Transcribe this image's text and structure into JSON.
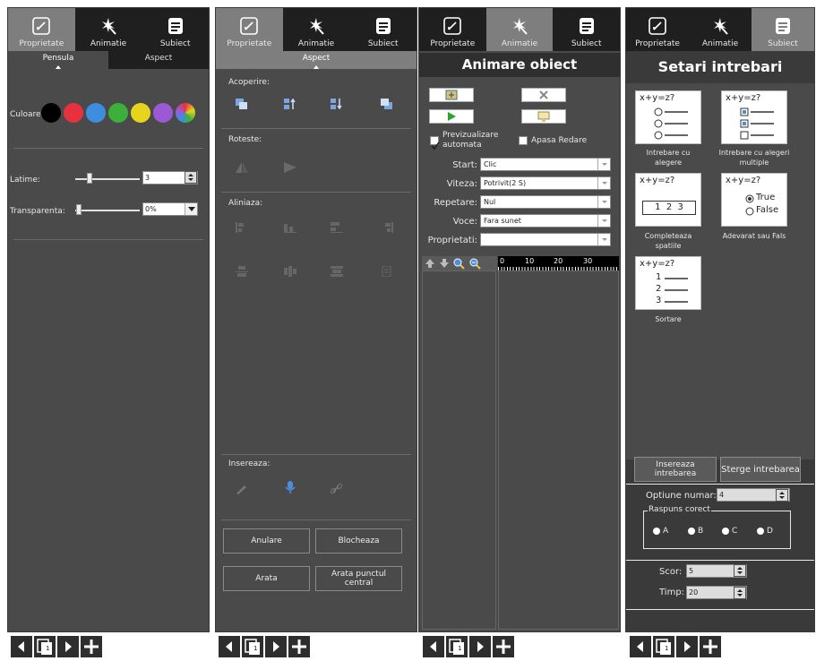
{
  "tabs": {
    "proprietate": "Proprietate",
    "animatie": "Animatie",
    "subiect": "Subiect"
  },
  "panel1": {
    "subtabs": [
      "Pensula",
      "Aspect"
    ],
    "culoare_label": "Culoare",
    "colors": [
      "#000000",
      "#e8313e",
      "#3e8ee0",
      "#3bb13b",
      "#e6d51c",
      "#9b59d6",
      "rainbow"
    ],
    "latime_label": "Latime:",
    "latime_value": "3",
    "transparenta_label": "Transparenta:",
    "transparenta_value": "0%"
  },
  "panel2": {
    "subtab": "Aspect",
    "acoperire": "Acoperire:",
    "roteste": "Roteste:",
    "aliniaza": "Aliniaza:",
    "insereaza": "Insereaza:",
    "buttons": {
      "anulare": "Anulare",
      "blocheaza": "Blocheaza",
      "arata": "Arata",
      "arata_central": "Arata punctul central"
    }
  },
  "panel3": {
    "title": "Animare obiect",
    "preview_label": "Previzualizare automata",
    "apasa_label": "Apasa Redare",
    "fields": [
      {
        "label": "Start:",
        "value": "Clic"
      },
      {
        "label": "Viteza:",
        "value": "Potrivit(2 S)"
      },
      {
        "label": "Repetare:",
        "value": "Nul"
      },
      {
        "label": "Voce:",
        "value": "Fara sunet"
      },
      {
        "label": "Proprietati:",
        "value": ""
      }
    ],
    "ruler": [
      "0",
      "10",
      "20",
      "30"
    ]
  },
  "panel4": {
    "title": "Setari intrebari",
    "eq": "x+y=z?",
    "cards": [
      "Intrebare cu alegere",
      "Intrebare cu alegeri multiple",
      "Completeaza spatiile",
      "Adevarat sau Fals",
      "Sortare"
    ],
    "blank_values": "1  2  3",
    "true_label": "True",
    "false_label": "False",
    "sort_nums": [
      "1",
      "2",
      "3"
    ],
    "insert_btn": "Insereaza intrebarea",
    "delete_btn": "Sterge intrebarea",
    "optiune_label": "Optiune numar:",
    "optiune_value": "4",
    "raspuns_label": "Raspuns corect",
    "answers": [
      "A",
      "B",
      "C",
      "D"
    ],
    "scor_label": "Scor:",
    "scor_value": "5",
    "timp_label": "Timp:",
    "timp_value": "20"
  },
  "page_number": "1",
  "colors": {
    "panel_bg": "#4a4a4a",
    "tab_bg": "#1f1f1f",
    "active_tab": "#7e7e7e"
  }
}
